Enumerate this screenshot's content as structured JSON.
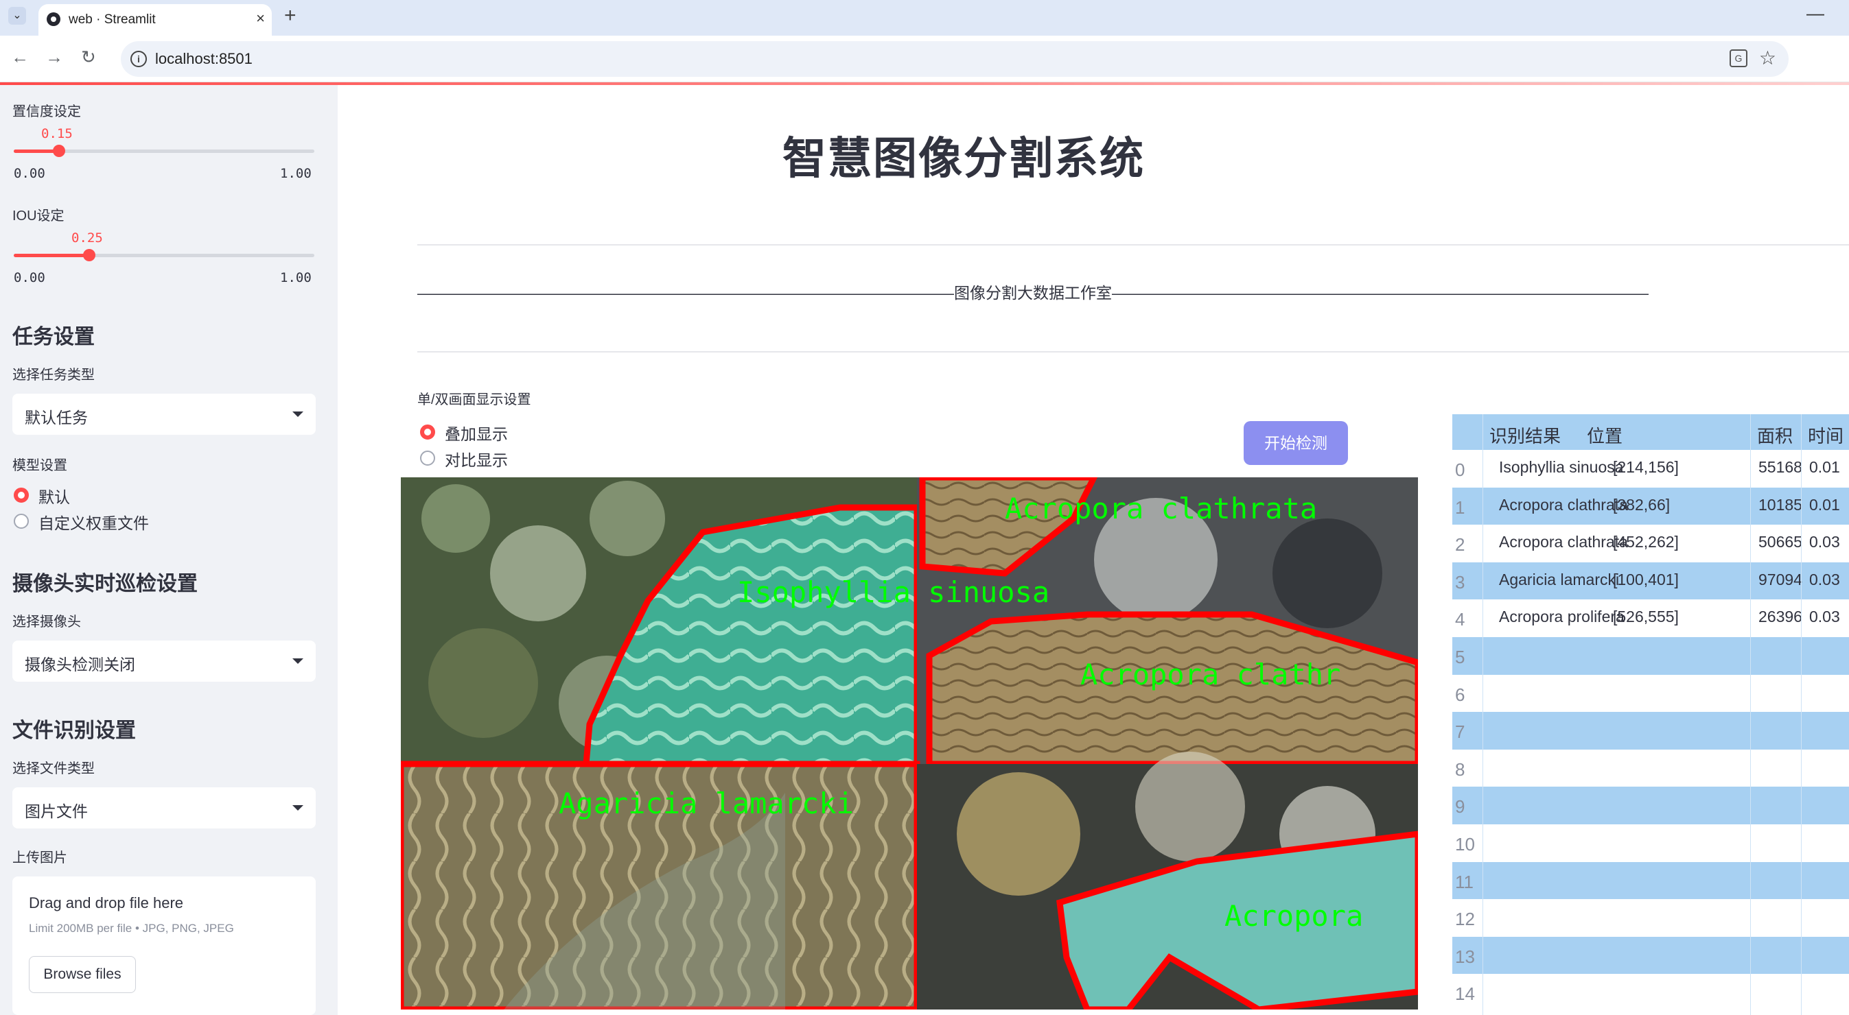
{
  "browser": {
    "tab_title": "web · Streamlit",
    "url": "localhost:8501"
  },
  "sidebar": {
    "confidence": {
      "label": "置信度设定",
      "value": "0.15",
      "min": "0.00",
      "max": "1.00",
      "fraction": 0.15
    },
    "iou": {
      "label": "IOU设定",
      "value": "0.25",
      "min": "0.00",
      "max": "1.00",
      "fraction": 0.25
    },
    "task_section": {
      "title": "任务设置",
      "select_label": "选择任务类型",
      "selected": "默认任务"
    },
    "model_section": {
      "label": "模型设置",
      "options": [
        "默认",
        "自定义权重文件"
      ],
      "selected_index": 0
    },
    "camera_section": {
      "title": "摄像头实时巡检设置",
      "select_label": "选择摄像头",
      "selected": "摄像头检测关闭"
    },
    "file_section": {
      "title": "文件识别设置",
      "select_label": "选择文件类型",
      "selected": "图片文件"
    },
    "upload": {
      "label": "上传图片",
      "title": "Drag and drop file here",
      "limit": "Limit 200MB per file • JPG, PNG, JPEG",
      "button": "Browse files"
    }
  },
  "main": {
    "title": "智慧图像分割系统",
    "subtitle_line": "——————————————————————————————————图像分割大数据工作室——————————————————————————————————",
    "display_setting_label": "单/双画面显示设置",
    "display_options": [
      "叠加显示",
      "对比显示"
    ],
    "display_selected_index": 0,
    "start_button": "开始检测",
    "image_labels": [
      "Acropora clathrata",
      "Isophyllia sinuosa",
      "Acropora clathr",
      "Agaricia lamarcki",
      "Acropora"
    ]
  },
  "table": {
    "headers": [
      "识别结果",
      "位置",
      "面积",
      "时间"
    ],
    "rows": [
      {
        "idx": "0",
        "result": "Isophyllia sinuosa",
        "position": "[214,156]",
        "area": "55168",
        "time": "0.01"
      },
      {
        "idx": "1",
        "result": "Acropora clathrata",
        "position": "[382,66]",
        "area": "10185",
        "time": "0.01"
      },
      {
        "idx": "2",
        "result": "Acropora clathrata",
        "position": "[452,262]",
        "area": "50665",
        "time": "0.03"
      },
      {
        "idx": "3",
        "result": "Agaricia lamarcki",
        "position": "[100,401]",
        "area": "97094",
        "time": "0.03"
      },
      {
        "idx": "4",
        "result": "Acropora prolifera",
        "position": "[526,555]",
        "area": "26396",
        "time": "0.03"
      },
      {
        "idx": "5"
      },
      {
        "idx": "6"
      },
      {
        "idx": "7"
      },
      {
        "idx": "8"
      },
      {
        "idx": "9"
      },
      {
        "idx": "10"
      },
      {
        "idx": "11"
      },
      {
        "idx": "12"
      },
      {
        "idx": "13"
      },
      {
        "idx": "14"
      }
    ]
  },
  "colors": {
    "accent": "#ff4b4b",
    "button": "#8c8ff0",
    "table_stripe": "#a7d0f2",
    "mask_outline": "#ff0000",
    "label_text": "#00ff00"
  }
}
